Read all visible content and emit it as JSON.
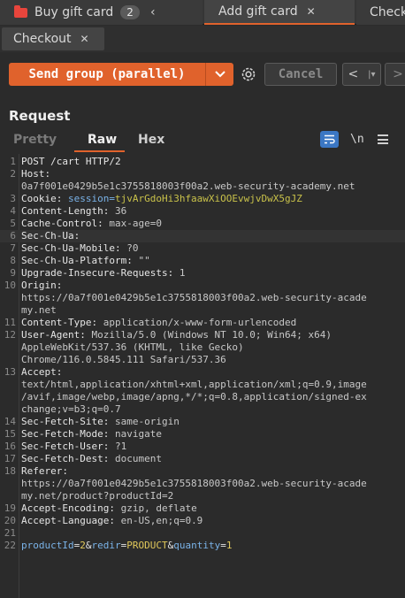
{
  "tabs": [
    {
      "label": "Buy gift card",
      "count": "2"
    },
    {
      "label": "Add gift card"
    },
    {
      "label": "Check"
    }
  ],
  "tabs_row2": [
    {
      "label": "Checkout"
    }
  ],
  "toolbar": {
    "send_label": "Send group (parallel)",
    "cancel_label": "Cancel"
  },
  "request": {
    "title": "Request",
    "subtabs": [
      "Pretty",
      "Raw",
      "Hex"
    ],
    "newline_label": "\\n"
  },
  "colors": {
    "accent": "#e0622c",
    "wrap_button": "#3b77c4"
  },
  "lines": [
    {
      "n": "1",
      "k": "POST /cart HTTP/2",
      "v": ""
    },
    {
      "n": "2",
      "k": "Host:",
      "v": ""
    },
    {
      "n": "",
      "k": "",
      "v": "0a7f001e0429b5e1c3755818003f00a2.web-security-academy.net"
    },
    {
      "n": "3",
      "k": "Cookie: ",
      "v": "session=",
      "tok": "tjvArGdoHi3hfaawXiOOEvwjvDwX5gJZ"
    },
    {
      "n": "4",
      "k": "Content-Length: ",
      "v": "36"
    },
    {
      "n": "5",
      "k": "Cache-Control: ",
      "v": "max-age=0"
    },
    {
      "n": "6",
      "k": "Sec-Ch-Ua:",
      "v": ""
    },
    {
      "n": "7",
      "k": "Sec-Ch-Ua-Mobile: ",
      "v": "?0"
    },
    {
      "n": "8",
      "k": "Sec-Ch-Ua-Platform: ",
      "v": "\"\""
    },
    {
      "n": "9",
      "k": "Upgrade-Insecure-Requests: ",
      "v": "1"
    },
    {
      "n": "10",
      "k": "Origin:",
      "v": ""
    },
    {
      "n": "",
      "k": "",
      "v": "https://0a7f001e0429b5e1c3755818003f00a2.web-security-acade"
    },
    {
      "n": "",
      "k": "",
      "v": "my.net"
    },
    {
      "n": "11",
      "k": "Content-Type: ",
      "v": "application/x-www-form-urlencoded"
    },
    {
      "n": "12",
      "k": "User-Agent: ",
      "v": "Mozilla/5.0 (Windows NT 10.0; Win64; x64)"
    },
    {
      "n": "",
      "k": "",
      "v": "AppleWebKit/537.36 (KHTML, like Gecko)"
    },
    {
      "n": "",
      "k": "",
      "v": "Chrome/116.0.5845.111 Safari/537.36"
    },
    {
      "n": "13",
      "k": "Accept:",
      "v": ""
    },
    {
      "n": "",
      "k": "",
      "v": "text/html,application/xhtml+xml,application/xml;q=0.9,image"
    },
    {
      "n": "",
      "k": "",
      "v": "/avif,image/webp,image/apng,*/*;q=0.8,application/signed-ex"
    },
    {
      "n": "",
      "k": "",
      "v": "change;v=b3;q=0.7"
    },
    {
      "n": "14",
      "k": "Sec-Fetch-Site: ",
      "v": "same-origin"
    },
    {
      "n": "15",
      "k": "Sec-Fetch-Mode: ",
      "v": "navigate"
    },
    {
      "n": "16",
      "k": "Sec-Fetch-User: ",
      "v": "?1"
    },
    {
      "n": "17",
      "k": "Sec-Fetch-Dest: ",
      "v": "document"
    },
    {
      "n": "18",
      "k": "Referer:",
      "v": ""
    },
    {
      "n": "",
      "k": "",
      "v": "https://0a7f001e0429b5e1c3755818003f00a2.web-security-acade"
    },
    {
      "n": "",
      "k": "",
      "v": "my.net/product?productId=2"
    },
    {
      "n": "19",
      "k": "Accept-Encoding: ",
      "v": "gzip, deflate"
    },
    {
      "n": "20",
      "k": "Accept-Language: ",
      "v": "en-US,en;q=0.9"
    },
    {
      "n": "21",
      "k": "",
      "v": ""
    },
    {
      "n": "22",
      "body": [
        {
          "t": "productId",
          "c": "pk"
        },
        {
          "t": "=",
          "c": "k"
        },
        {
          "t": "2",
          "c": "pv"
        },
        {
          "t": "&",
          "c": "k"
        },
        {
          "t": "redir",
          "c": "pk"
        },
        {
          "t": "=",
          "c": "k"
        },
        {
          "t": "PRODUCT",
          "c": "pv"
        },
        {
          "t": "&",
          "c": "k"
        },
        {
          "t": "quantity",
          "c": "pk"
        },
        {
          "t": "=",
          "c": "k"
        },
        {
          "t": "1",
          "c": "pv"
        }
      ]
    }
  ]
}
